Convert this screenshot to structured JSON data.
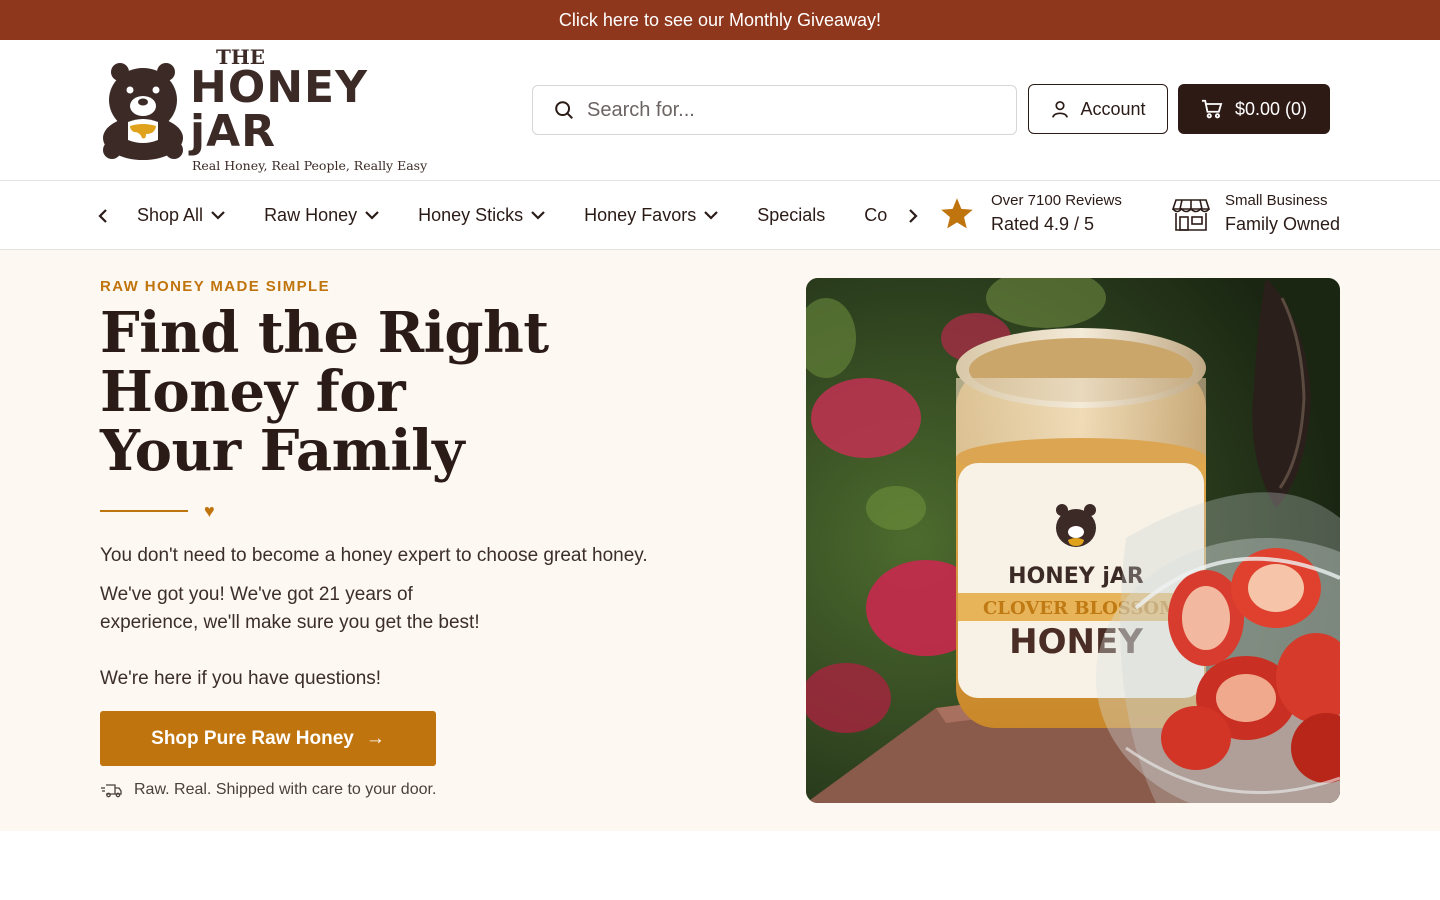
{
  "promo": {
    "text": "Click here to see our Monthly Giveaway!"
  },
  "logo": {
    "the": "THE",
    "name": "HONEY jAR",
    "tagline": "Real Honey, Real People, Really Easy"
  },
  "search": {
    "placeholder": "Search for...",
    "value": ""
  },
  "account": {
    "label": "Account"
  },
  "cart": {
    "label": "$0.00 (0)"
  },
  "nav": {
    "items": [
      {
        "label": "Shop All",
        "has_dropdown": true
      },
      {
        "label": "Raw Honey",
        "has_dropdown": true
      },
      {
        "label": "Honey Sticks",
        "has_dropdown": true
      },
      {
        "label": "Honey Favors",
        "has_dropdown": true
      },
      {
        "label": "Specials",
        "has_dropdown": false
      },
      {
        "label": "Co",
        "has_dropdown": false
      }
    ]
  },
  "badges": {
    "reviews": {
      "small": "Over 7100 Reviews",
      "big": "Rated 4.9 / 5",
      "icon": "star-icon"
    },
    "business": {
      "small": "Small Business",
      "big": "Family Owned",
      "icon": "storefront-icon"
    }
  },
  "hero": {
    "eyebrow": "RAW HONEY MADE SIMPLE",
    "headline_1": "Find the Right",
    "headline_2": "Honey for",
    "headline_3": "Your Family",
    "p1": "You don't need to become a honey expert to choose great honey.",
    "p2": "We've got you! We've got 21 years of experience, we'll make sure you get the best!",
    "p3": "We're here if you have questions!",
    "cta": "Shop Pure Raw Honey",
    "cta_arrow": "→",
    "shipping": "Raw. Real. Shipped with care to your door.",
    "image_jar_brand": "HONEY jAR",
    "image_jar_variety": "CLOVER BLOSSOM",
    "image_jar_word": "HONEY"
  },
  "colors": {
    "promo": "#8f371c",
    "accent": "#c0740d",
    "dark": "#2e1a15",
    "hero_bg": "#fdf8f2"
  }
}
